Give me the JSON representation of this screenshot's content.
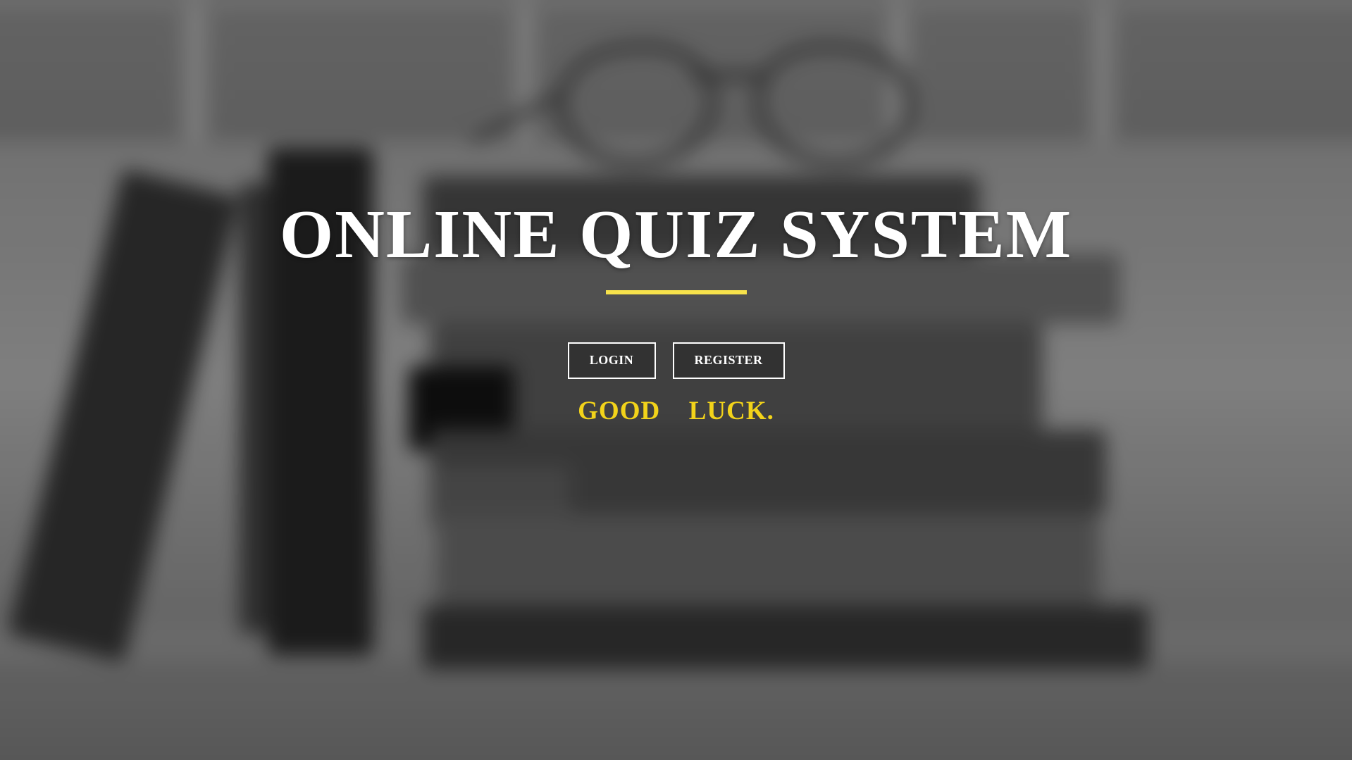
{
  "page": {
    "title": "ONLINE QUIZ SYSTEM",
    "accent_color": "#f7e24b",
    "tagline_color": "#f2d31a"
  },
  "actions": {
    "login_label": "LOGIN",
    "register_label": "REGISTER"
  },
  "tagline": "GOOD  LUCK.",
  "background": {
    "description_icon": "books-and-glasses-photo",
    "style": "blurred grayscale"
  }
}
